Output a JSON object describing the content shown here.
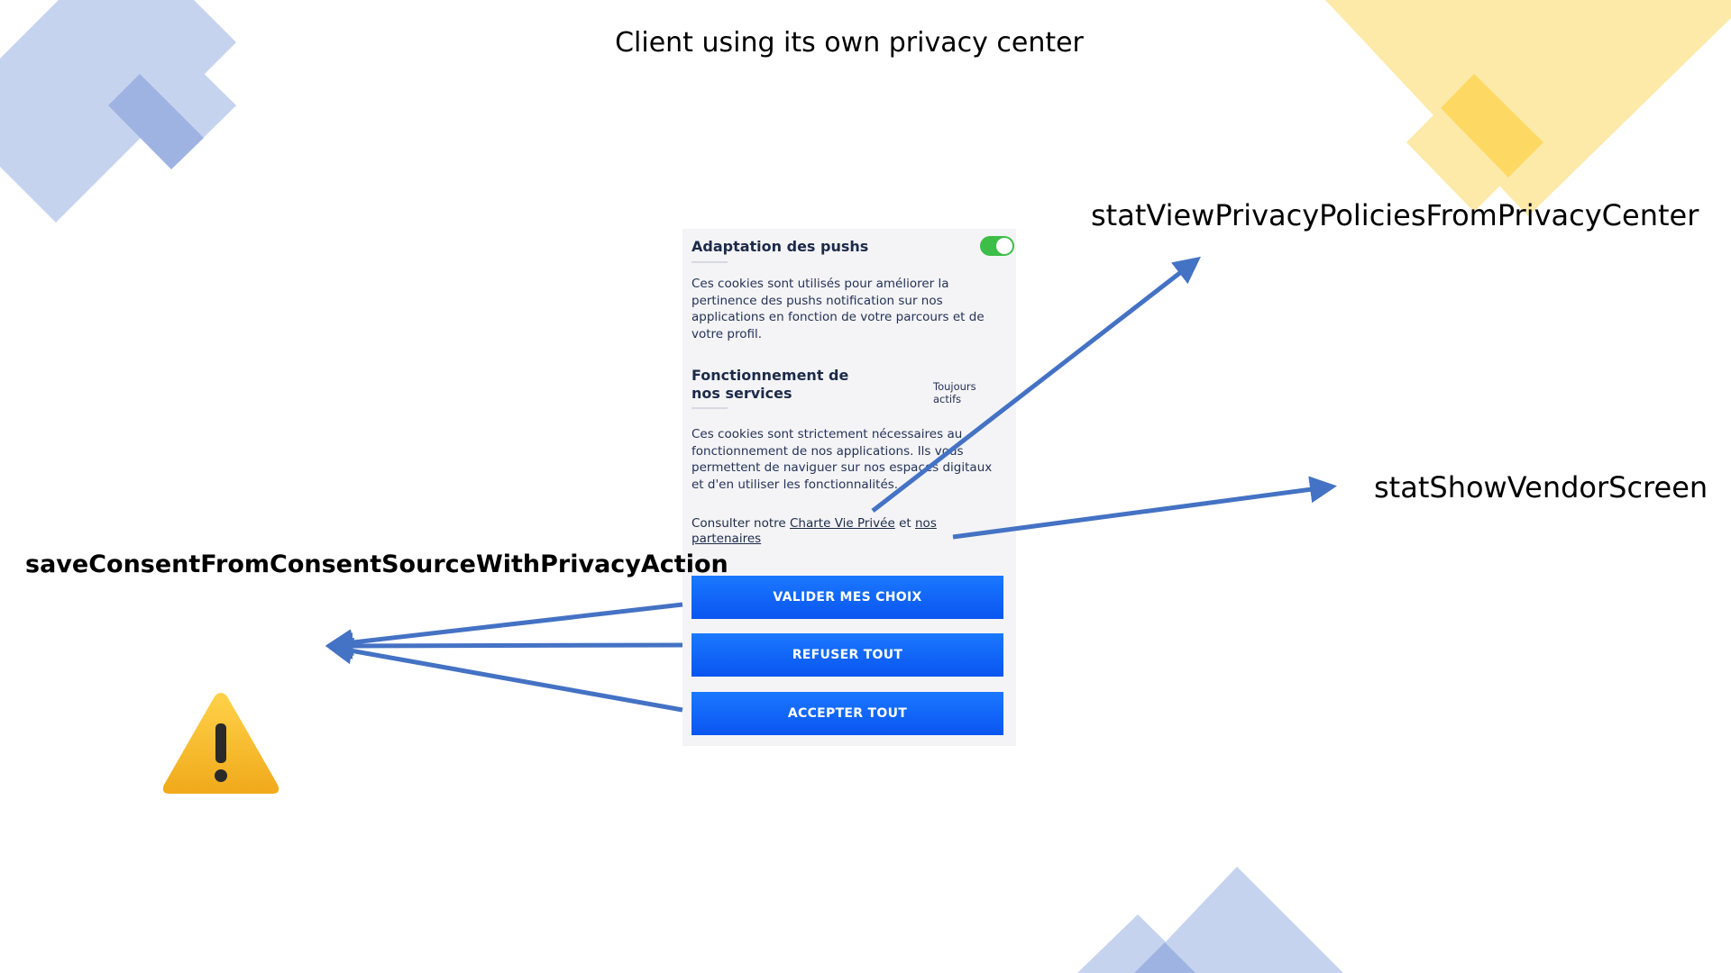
{
  "slide": {
    "title": "Client using its own privacy center"
  },
  "labels": {
    "privacy_policies": "statViewPrivacyPoliciesFromPrivacyCenter",
    "vendor_screen": "statShowVendorScreen",
    "save_consent": "saveConsentFromConsentSourceWithPrivacyAction"
  },
  "privacy_center": {
    "section_1": {
      "title": "Adaptation des pushs",
      "toggle_on": true,
      "description": "Ces cookies sont utilisés pour améliorer la pertinence des pushs notification sur nos applications en fonction de votre parcours et de votre profil."
    },
    "section_2": {
      "title": "Fonctionnement de nos services",
      "status": "Toujours actifs",
      "description": "Ces cookies sont strictement nécessaires au fonctionnement de nos applications. Ils vous permettent de naviguer sur nos espaces digitaux et d'en utiliser les fonctionnalités."
    },
    "consult": {
      "prefix": "Consulter notre",
      "privacy_link": "Charte Vie Privée",
      "and": "et",
      "partners_link": "nos partenaires"
    },
    "buttons": {
      "validate": "VALIDER MES CHOIX",
      "refuse": "REFUSER TOUT",
      "accept": "ACCEPTER TOUT"
    }
  },
  "icons": {
    "warning": "warning-icon"
  },
  "colors": {
    "arrow": "#4472c4",
    "cta": "#0d5ef4",
    "toggle": "#3cbe48",
    "deco_blue": "#c5d3ee",
    "deco_blue_dark": "#9fb3e3",
    "deco_yellow": "#fde9a8",
    "deco_yellow_dark": "#fdd964"
  }
}
